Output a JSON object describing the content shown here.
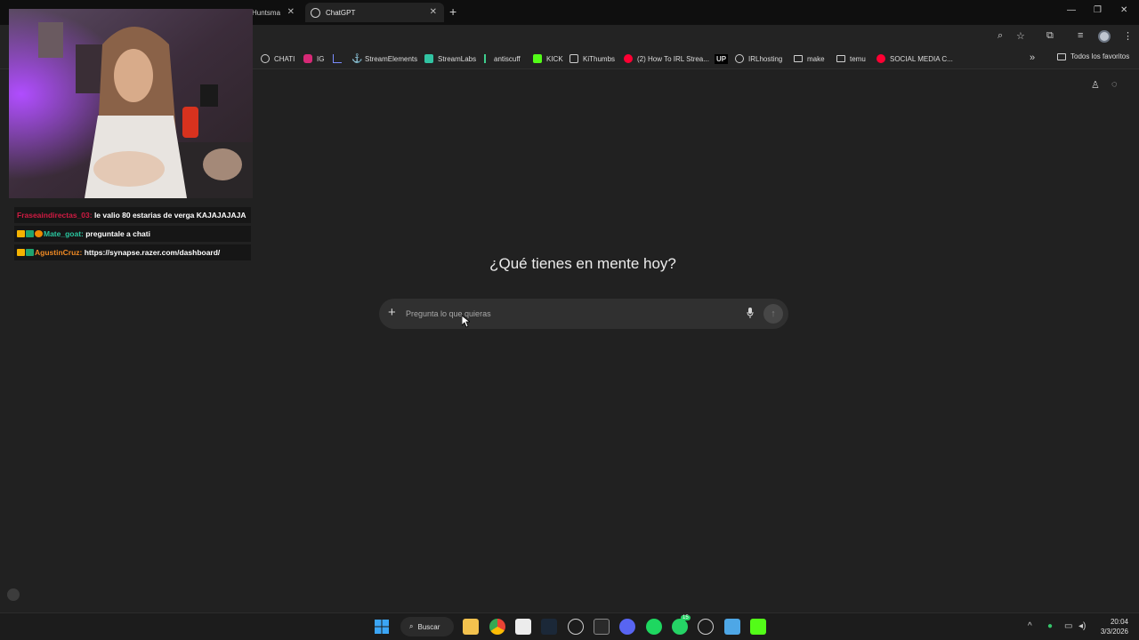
{
  "browser": {
    "tabs": [
      {
        "label": "Huntsma",
        "active": false
      },
      {
        "label": "ChatGPT",
        "active": true
      }
    ],
    "new_tab_icon": "plus-icon"
  },
  "bookmarks": {
    "items": [
      {
        "label": "CHATI",
        "icon": "openai-icon",
        "color": "#cfcfcf"
      },
      {
        "label": "IG",
        "icon": "instagram-icon",
        "color": "#d62976"
      },
      {
        "label": "",
        "icon": "chart-icon",
        "color": "#7b8cff"
      },
      {
        "label": "StreamElements",
        "icon": "anchor-icon",
        "color": "#cfcfcf"
      },
      {
        "label": "StreamLabs",
        "icon": "streamlabs-icon",
        "color": "#31c3a2"
      },
      {
        "label": "antiscuff",
        "icon": "bar-icon",
        "color": "#3ecf8e"
      },
      {
        "label": "KICK",
        "icon": "kick-icon",
        "color": "#53fc18"
      },
      {
        "label": "KiThumbs",
        "icon": "thumb-icon",
        "color": "#cfcfcf"
      },
      {
        "label": "(2) How To IRL Strea...",
        "icon": "youtube-icon",
        "color": "#ff0033"
      },
      {
        "label": "UP",
        "icon": "up-icon",
        "color": "#ffffff"
      },
      {
        "label": "IRLhosting",
        "icon": "globe-icon",
        "color": "#cfcfcf"
      },
      {
        "label": "make",
        "icon": "folder-icon",
        "color": "#cfcfcf"
      },
      {
        "label": "temu",
        "icon": "folder-icon",
        "color": "#cfcfcf"
      },
      {
        "label": "SOCIAL MEDIA C...",
        "icon": "youtube-icon",
        "color": "#ff0033"
      }
    ],
    "all_label": "Todos los favoritos"
  },
  "main": {
    "heading": "¿Qué tienes en mente hoy?",
    "composer_placeholder": "Pregunta lo que quieras"
  },
  "chat": {
    "messages": [
      {
        "user": "Fraseaindirectas_03:",
        "text": " le valio 80 estarias de verga KAJAJAJAJA",
        "user_color": "#d11b43",
        "badges": []
      },
      {
        "user": "Mate_goat:",
        "text": " preguntale a chati",
        "user_color": "#2ac7a0",
        "badges": [
          "#f5b301",
          "#1fa36f",
          "#f08a00"
        ]
      },
      {
        "user": "AgustinCruz:",
        "text": " https://synapse.razer.com/dashboard/",
        "user_color": "#f08a24",
        "badges": [
          "#f5b301",
          "#1fa36f"
        ]
      }
    ]
  },
  "taskbar": {
    "search_label": "Buscar",
    "time": "20:04",
    "date": "3/3/2026",
    "badges": {
      "whatsapp": "15"
    }
  },
  "colors": {
    "page_bg": "#212121",
    "composer_bg": "#303030",
    "kick_green": "#53fc18"
  }
}
